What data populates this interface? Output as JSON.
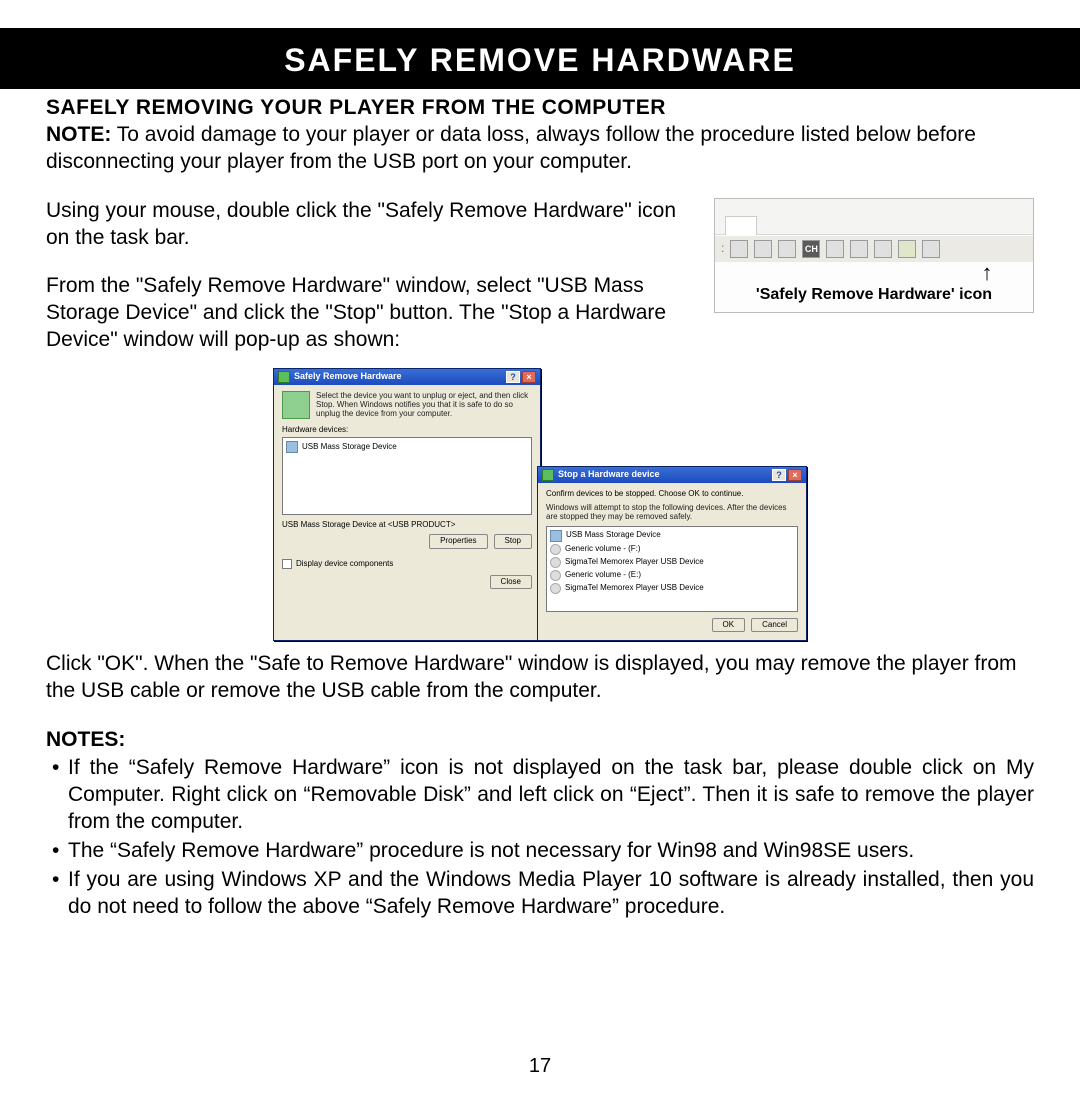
{
  "banner": "SAFELY REMOVE HARDWARE",
  "subhead": "SAFELY REMOVING YOUR PLAYER FROM THE COMPUTER",
  "note_label": "NOTE:",
  "note_text": " To avoid damage to your player or data loss, always follow the procedure listed below before disconnecting your player from the USB port on your computer.",
  "p1": "Using your mouse, double click the \"Safely Remove Hardware\" icon on the task bar.",
  "p2": "From the \"Safely Remove Hardware\" window, select \"USB Mass Storage Device\" and click the \"Stop\" button. The \"Stop a Hardware Device\" window will pop-up as shown:",
  "tray_caption": "'Safely Remove Hardware' icon",
  "dialog1": {
    "title": "Safely Remove Hardware",
    "desc": "Select the device you want to unplug or eject, and then click Stop. When Windows notifies you that it is safe to do so unplug the device from your computer.",
    "label": "Hardware devices:",
    "item": "USB Mass Storage Device",
    "at": "USB Mass Storage Device at <USB PRODUCT>",
    "btn_props": "Properties",
    "btn_stop": "Stop",
    "chk": "Display device components",
    "btn_close": "Close"
  },
  "dialog2": {
    "title": "Stop a Hardware device",
    "desc2": "Confirm devices to be stopped. Choose OK to continue.",
    "desc3": "Windows will attempt to stop the following devices. After the devices are stopped they may be removed safely.",
    "items": [
      "USB Mass Storage Device",
      "Generic volume - (F:)",
      "SigmaTel Memorex Player USB Device",
      "Generic volume - (E:)",
      "SigmaTel Memorex Player USB Device"
    ],
    "btn_ok": "OK",
    "btn_cancel": "Cancel"
  },
  "p3": "Click \"OK\". When the \"Safe to Remove Hardware\" window is displayed, you may remove the player from the USB cable or remove the USB cable from the computer.",
  "notes_head": "NOTES:",
  "notes": [
    "If the “Safely Remove Hardware” icon is not displayed on the task bar, please double click on My Computer.  Right click on “Removable Disk” and left click on “Eject”.  Then it is safe to remove the player from the computer.",
    "The “Safely Remove Hardware” procedure is not necessary for Win98 and Win98SE users.",
    "If you are using Windows XP and the Windows Media Player 10 software is already installed, then you do not need to follow the above “Safely Remove Hardware” procedure."
  ],
  "page": "17"
}
